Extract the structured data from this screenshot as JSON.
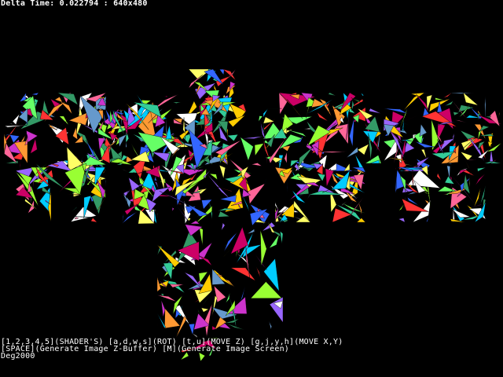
{
  "hud": {
    "delta_time_line": "Delta Time: 0.022794 : 640x480",
    "controls_line_1": "[1,2,3,4,5](SHADER'S) [a,d,w,s](ROT) [t,u](MOVE Z) [g,j,y,h](MOVE X,Y)",
    "controls_line_2": "[SPACE](Generate Image Z-Buffer) [M](Generate Image Screen)",
    "credit_line": "Deg2000"
  },
  "scene": {
    "background_color": "#000000",
    "palette": [
      "#ff6699",
      "#33cc99",
      "#ffcc00",
      "#3366ff",
      "#cc33cc",
      "#66ff66",
      "#ff3333",
      "#00ccff",
      "#ffffff",
      "#9966ff",
      "#ff9933",
      "#339966",
      "#cc0066",
      "#99ff33",
      "#6699cc",
      "#ffff66"
    ]
  }
}
